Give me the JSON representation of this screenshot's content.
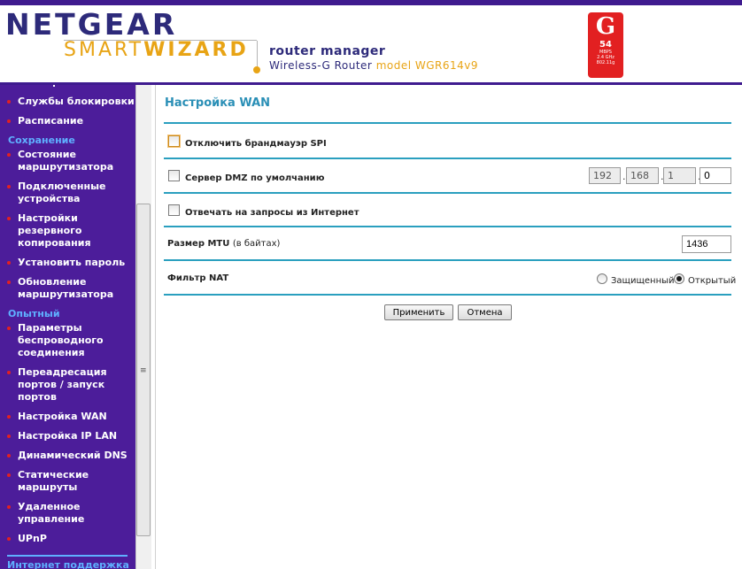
{
  "header": {
    "brand": "NETGEAR",
    "product_smart": "SMART",
    "product_wizard": "WIZARD",
    "subtitle": "router manager",
    "device": "Wireless-G Router",
    "model": "model WGR614v9",
    "badge": {
      "letter": "G",
      "speed": "54",
      "unit": "MBPS",
      "band": "2.4 GHz",
      "standard": "802.11g"
    }
  },
  "sidebar": {
    "items": [
      {
        "type": "item",
        "label": "Блокировка сайтов"
      },
      {
        "type": "item",
        "label": "Службы блокировки"
      },
      {
        "type": "item",
        "label": "Расписание"
      },
      {
        "type": "section",
        "label": "Сохранение"
      },
      {
        "type": "item",
        "label": "Состояние маршрутизатора"
      },
      {
        "type": "item",
        "label": "Подключенные устройства"
      },
      {
        "type": "item",
        "label": "Настройки резервного копирования"
      },
      {
        "type": "item",
        "label": "Установить пароль"
      },
      {
        "type": "item",
        "label": "Обновление маршрутизатора"
      },
      {
        "type": "section",
        "label": "Опытный"
      },
      {
        "type": "item",
        "label": "Параметры беспроводного соединения"
      },
      {
        "type": "item",
        "label": "Переадресация портов / запуск портов"
      },
      {
        "type": "item",
        "label": "Настройка WAN"
      },
      {
        "type": "item",
        "label": "Настройка IP LAN"
      },
      {
        "type": "item",
        "label": "Динамический DNS"
      },
      {
        "type": "item",
        "label": "Статические маршруты"
      },
      {
        "type": "item",
        "label": "Удаленное управление"
      },
      {
        "type": "item",
        "label": "UPnP"
      }
    ],
    "footer": "Интернет поддержка"
  },
  "main": {
    "title": "Настройка WAN",
    "spi": {
      "label": "Отключить брандмауэр SPI",
      "checked": false
    },
    "dmz": {
      "label": "Сервер DMZ по умолчанию",
      "checked": false,
      "ip": [
        "192",
        "168",
        "1",
        "0"
      ]
    },
    "ping": {
      "label": "Отвечать на запросы из Интернет",
      "checked": false
    },
    "mtu": {
      "label": "Размер MTU",
      "unit": "(в байтах)",
      "value": "1436"
    },
    "nat": {
      "label": "Фильтр NAT",
      "options": [
        "Защищенный",
        "Открытый"
      ],
      "selected": "Открытый"
    },
    "buttons": {
      "apply": "Применить",
      "cancel": "Отмена"
    }
  },
  "colors": {
    "nav_bg": "#4c1d9a",
    "section": "#5fb0ff",
    "accent": "#2a9fbf",
    "bullet": "#e22021"
  }
}
